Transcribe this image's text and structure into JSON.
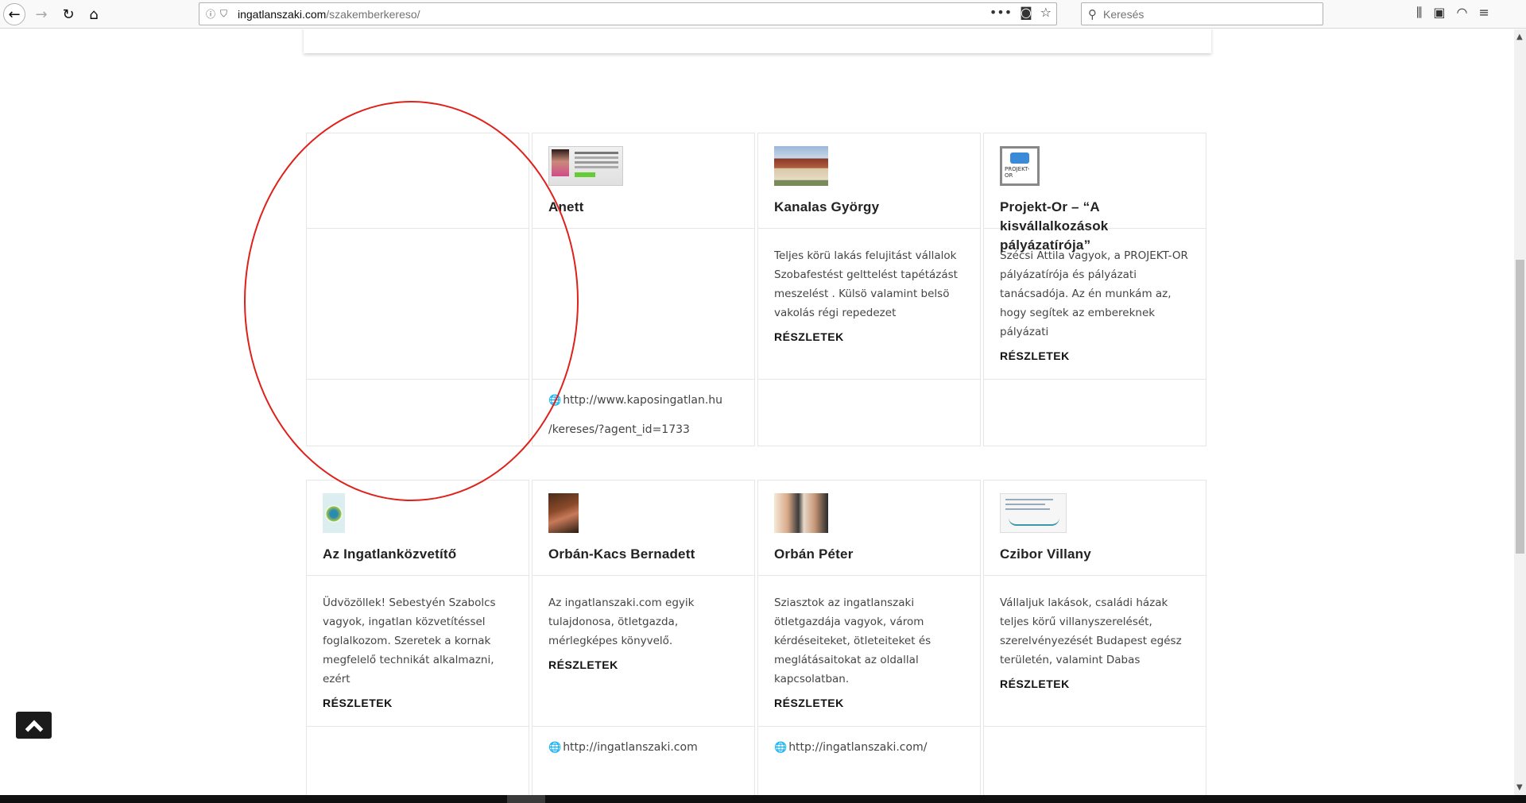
{
  "browser": {
    "url_domain": "ingatlanszaki.com",
    "url_path": "/szakemberkereso/",
    "search_placeholder": "Keresés"
  },
  "cards": [
    {
      "title": "",
      "desc": "",
      "more": "",
      "link1": "",
      "link2": ""
    },
    {
      "title": "Anett",
      "desc": "",
      "more": "",
      "link1": "http://www.kaposingatlan.hu",
      "link2": "/kereses/?agent_id=1733"
    },
    {
      "title": "Kanalas György",
      "desc": "Teljes körü lakás felujitást vállalok Szobafestést gelttelést tapétázást meszelést . Külsö valamint belsö vakolás régi repedezet",
      "more": "RÉSZLETEK",
      "link1": "",
      "link2": ""
    },
    {
      "title": "Projekt-Or – “A kisvállalkozások pályázatírója”",
      "desc": "Szécsi Attila vagyok, a PROJEKT-OR pályázatírója és pályázati tanácsadója. Az én munkám az, hogy segítek az embereknek pályázati",
      "more": "RÉSZLETEK",
      "link1": "",
      "link2": ""
    },
    {
      "title": "Az Ingatlanközvetítő",
      "desc": "Üdvözöllek! Sebestyén Szabolcs vagyok, ingatlan közvetítéssel foglalkozom. Szeretek a kornak megfelelő technikát alkalmazni, ezért",
      "more": "RÉSZLETEK",
      "link1": "",
      "link2": ""
    },
    {
      "title": "Orbán-Kacs Bernadett",
      "desc": "Az ingatlanszaki.com egyik tulajdonosa, ötletgazda, mérlegképes könyvelő.",
      "more": "RÉSZLETEK",
      "link1": "http://ingatlanszaki.com",
      "link2": ""
    },
    {
      "title": "Orbán Péter",
      "desc": "Sziasztok az ingatlanszaki ötletgazdája vagyok, várom kérdéseiteket, ötleteiteket és meglátásaitokat az oldallal kapcsolatban.",
      "more": "RÉSZLETEK",
      "link1": "http://ingatlanszaki.com/",
      "link2": ""
    },
    {
      "title": "Czibor Villany",
      "desc": "Vállaljuk lakások, családi házak teljes körű villanyszerelését, szerelvényezését Budapest egész területén, valamint Dabas",
      "more": "RÉSZLETEK",
      "link1": "",
      "link2": ""
    }
  ],
  "thumb_mini": {
    "projekt_text": "PROJEKT-OR"
  },
  "colors": {
    "annotation": "#e0201a",
    "back_to_top": "#1b1b1b"
  }
}
